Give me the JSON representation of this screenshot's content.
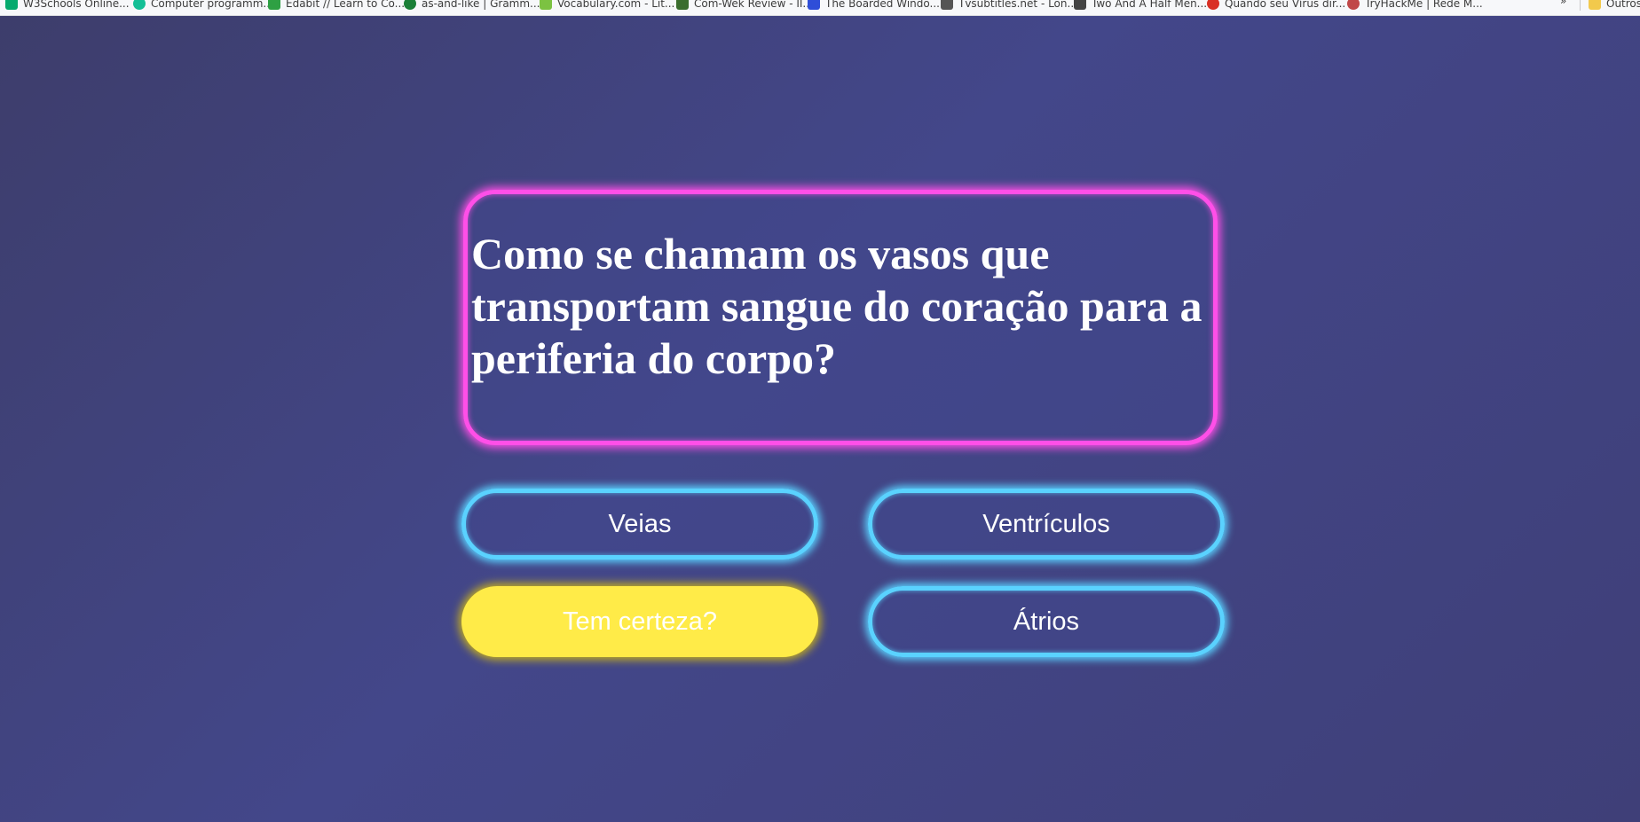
{
  "bookmarks": [
    {
      "label": "W3Schools Online...",
      "icon": "w3schools-icon",
      "color": "#04aa6d"
    },
    {
      "label": "Computer programm...",
      "icon": "hexagon-icon",
      "color": "#14bf96"
    },
    {
      "label": "Edabit // Learn to Co...",
      "icon": "edabit-icon",
      "color": "#2ea043"
    },
    {
      "label": "as-and-like | Gramm...",
      "icon": "grammar-icon",
      "color": "#1a7f37"
    },
    {
      "label": "Vocabulary.com - Lit...",
      "icon": "vocabulary-icon",
      "color": "#7cc242"
    },
    {
      "label": "Com-Wek Review - II...",
      "icon": "comwek-icon",
      "color": "#3b6e2e"
    },
    {
      "label": "The Boarded Windo...",
      "icon": "chart-icon",
      "color": "#2f4ed8"
    },
    {
      "label": "Tvsubtitles.net - Lon...",
      "icon": "tvsubtitles-icon",
      "color": "#555555"
    },
    {
      "label": "Two And A Half Men...",
      "icon": "film-icon",
      "color": "#444444"
    },
    {
      "label": "Quando seu Vírus dir...",
      "icon": "virus-icon",
      "color": "#d93025"
    },
    {
      "label": "TryHackMe | Redé M...",
      "icon": "tryhackme-icon",
      "color": "#c04848"
    }
  ],
  "bookmarks_overflow": "»",
  "bookmarks_other": "Outros",
  "quiz": {
    "question": "Como se chamam os vasos que transportam sangue do coração para a periferia do corpo?",
    "answers": {
      "a1": "Veias",
      "a2": "Ventrículos",
      "a3": "Tem certeza?",
      "a4": "Átrios"
    }
  },
  "colors": {
    "question_border": "#ff4fe8",
    "answer_border": "#5ad2ff",
    "selected_answer": "#ffeb48",
    "background": "#43478a"
  }
}
